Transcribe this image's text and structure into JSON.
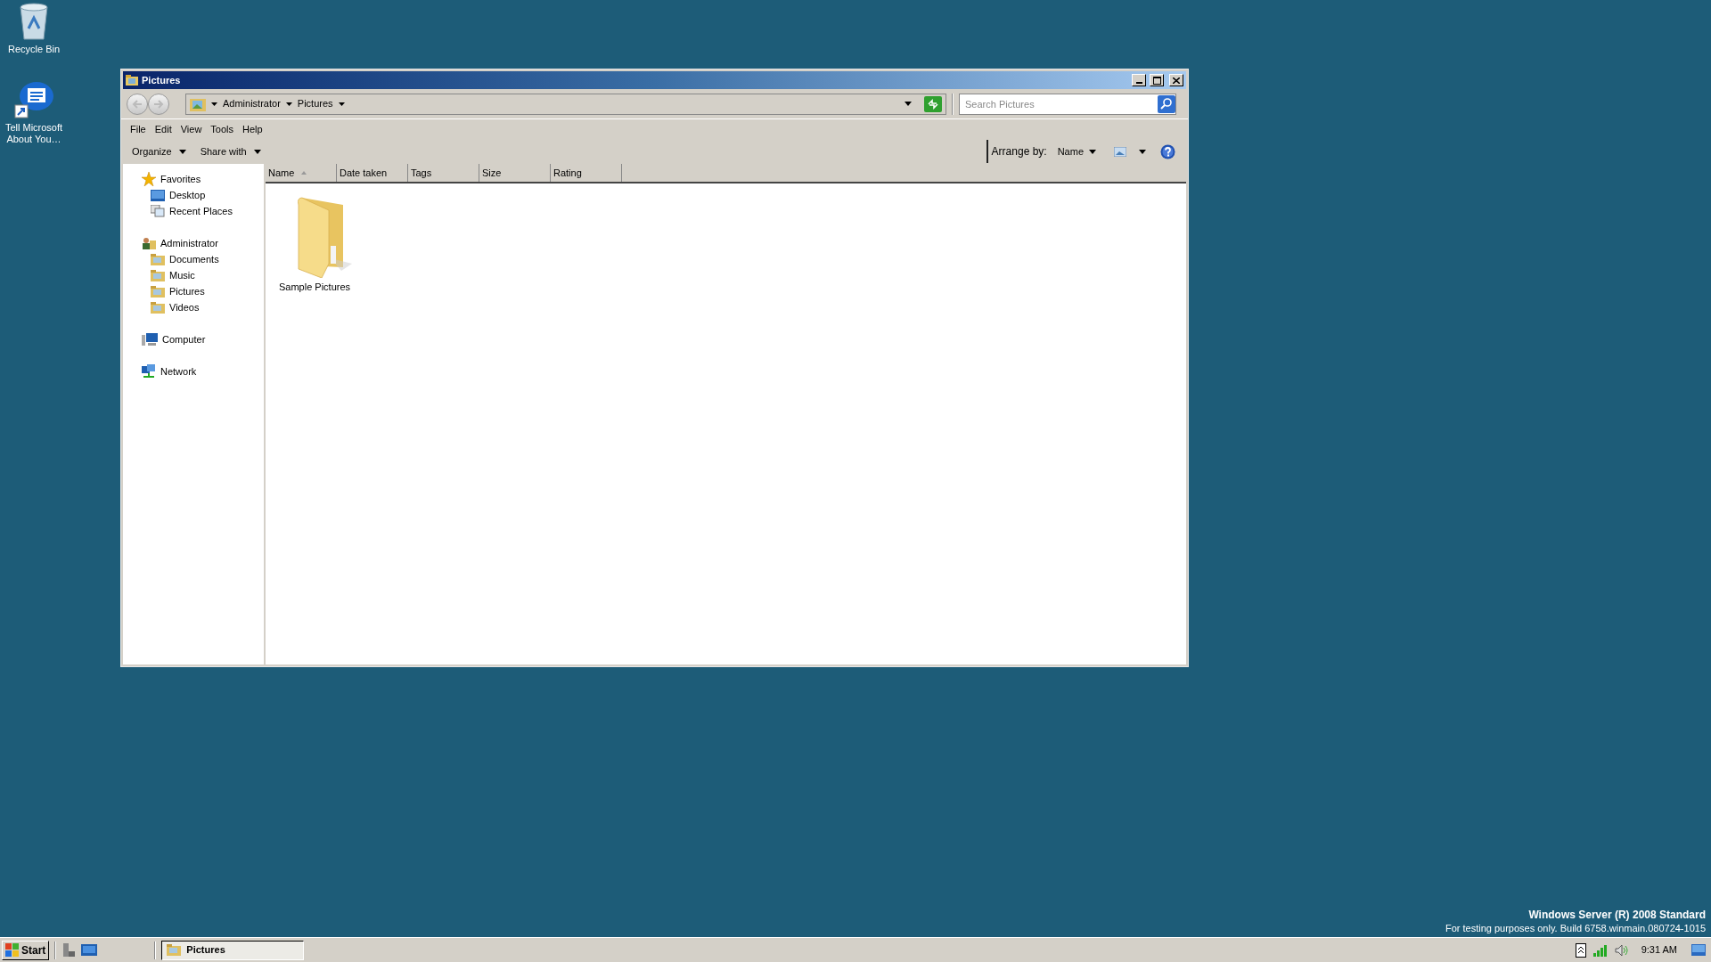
{
  "desktop_icons": [
    {
      "kind": "recycle",
      "label": "Recycle Bin"
    },
    {
      "kind": "feedback",
      "label": "Tell Microsoft About You…"
    }
  ],
  "window": {
    "title": "Pictures"
  },
  "breadcrumb": [
    "Administrator",
    "Pictures"
  ],
  "search": {
    "placeholder": "Search Pictures"
  },
  "menu": [
    "File",
    "Edit",
    "View",
    "Tools",
    "Help"
  ],
  "toolbar": [
    "Organize",
    "Share with"
  ],
  "arrange": {
    "label": "Arrange by:",
    "value": "Name"
  },
  "nav": [
    {
      "kind": "star",
      "label": "Favorites",
      "children": [
        {
          "kind": "desktop",
          "label": "Desktop"
        },
        {
          "kind": "recent",
          "label": "Recent Places"
        }
      ]
    },
    {
      "kind": "user",
      "label": "Administrator",
      "children": [
        {
          "kind": "folder",
          "label": "Documents"
        },
        {
          "kind": "folder",
          "label": "Music"
        },
        {
          "kind": "folder",
          "label": "Pictures"
        },
        {
          "kind": "folder",
          "label": "Videos"
        }
      ]
    },
    {
      "kind": "computer",
      "label": "Computer"
    },
    {
      "kind": "network",
      "label": "Network"
    }
  ],
  "columns": [
    {
      "label": "Name",
      "sorted": true
    },
    {
      "label": "Date taken",
      "sorted": false
    },
    {
      "label": "Tags",
      "sorted": false
    },
    {
      "label": "Size",
      "sorted": false
    },
    {
      "label": "Rating",
      "sorted": false
    }
  ],
  "items": [
    {
      "label": "Sample Pictures"
    }
  ],
  "watermark_text": [
    "Windows Server (R) 2008 Standard",
    "For testing purposes only. Build 6758.winmain.080724-1015"
  ],
  "taskbar": {
    "start": "Start",
    "tasks": [
      {
        "label": "Pictures",
        "selected": true
      }
    ],
    "clock": "9:31 AM"
  }
}
